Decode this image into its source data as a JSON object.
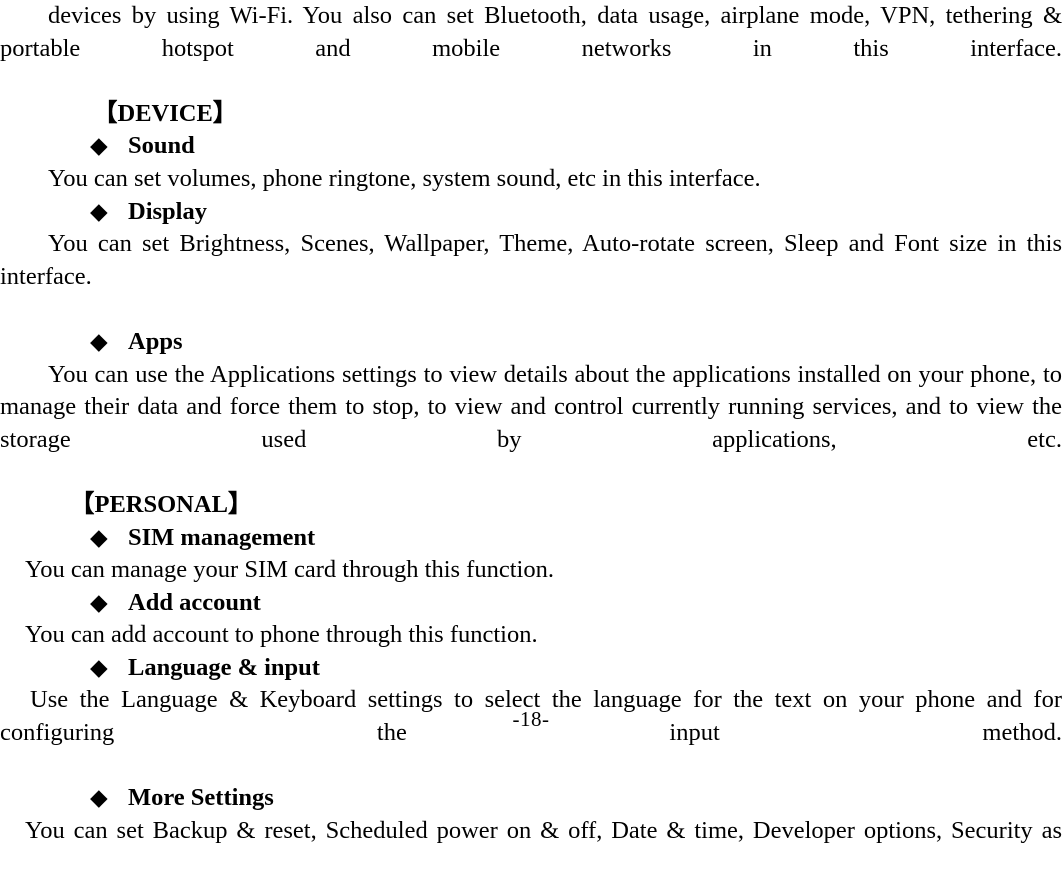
{
  "document": {
    "page_number": "-18-",
    "bullet_glyph": "◆",
    "bracket_open": "【",
    "bracket_close": "】",
    "text_color": "#000000",
    "background_color": "#ffffff"
  },
  "body": {
    "intro_paragraph": "devices by using Wi-Fi. You also can set Bluetooth, data usage, airplane mode, VPN, tethering & portable hotspot and mobile networks in this interface.",
    "sections": [
      {
        "heading": "【DEVICE】",
        "heading_text": "DEVICE",
        "items": [
          {
            "label": "Sound",
            "description": "You can set volumes, phone ringtone, system sound, etc in this interface."
          },
          {
            "label": "Display",
            "description": "You can set Brightness, Scenes, Wallpaper, Theme, Auto-rotate screen, Sleep and Font size in this interface."
          },
          {
            "label": "Apps",
            "description": "You can use the Applications settings to view details about the applications installed on your phone, to manage their data and force them to stop, to view and control currently running services, and to view the storage used by applications, etc."
          }
        ]
      },
      {
        "heading": "【PERSONAL】",
        "heading_text": "PERSONAL",
        "items": [
          {
            "label": "SIM management",
            "description": "You can manage your SIM card through this function."
          },
          {
            "label": "Add account",
            "description": "You can add account to phone through this function."
          },
          {
            "label": "Language & input",
            "description": "Use the Language & Keyboard settings to select the language for the text on your phone and for configuring the input method."
          },
          {
            "label": "More Settings",
            "description": "You can set Backup & reset, Scheduled power on & off, Date & time, Developer options, Security as"
          }
        ]
      }
    ]
  }
}
